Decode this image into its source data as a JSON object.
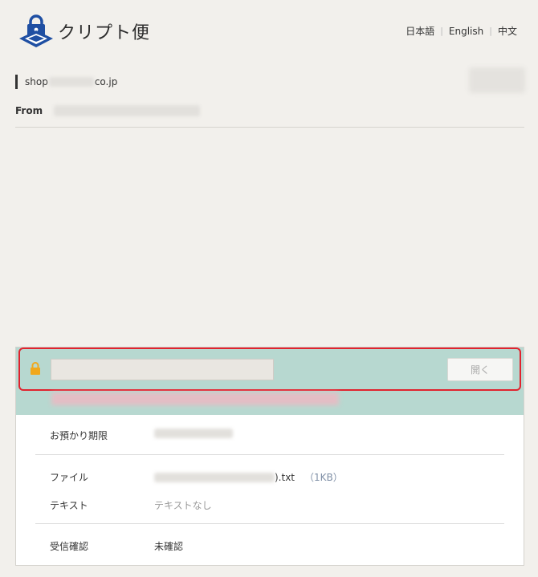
{
  "app": {
    "name": "クリプト便"
  },
  "languages": [
    "日本語",
    "English",
    "中文"
  ],
  "to": {
    "prefix": "shop",
    "suffix": "co.jp"
  },
  "from": {
    "label": "From"
  },
  "unlock": {
    "password_placeholder": "",
    "open_label": "開く"
  },
  "info": {
    "retention_label": "お預かり期限",
    "file_label": "ファイル",
    "file_ext": ").txt",
    "file_size": "（1KB）",
    "text_label": "テキスト",
    "text_value": "テキストなし",
    "receipt_label": "受信確認",
    "receipt_value": "未確認"
  },
  "colors": {
    "accent_band": "#b7d8d0",
    "highlight": "#e0232e",
    "lock": "#f0a81c",
    "logo": "#1f4fa3"
  }
}
